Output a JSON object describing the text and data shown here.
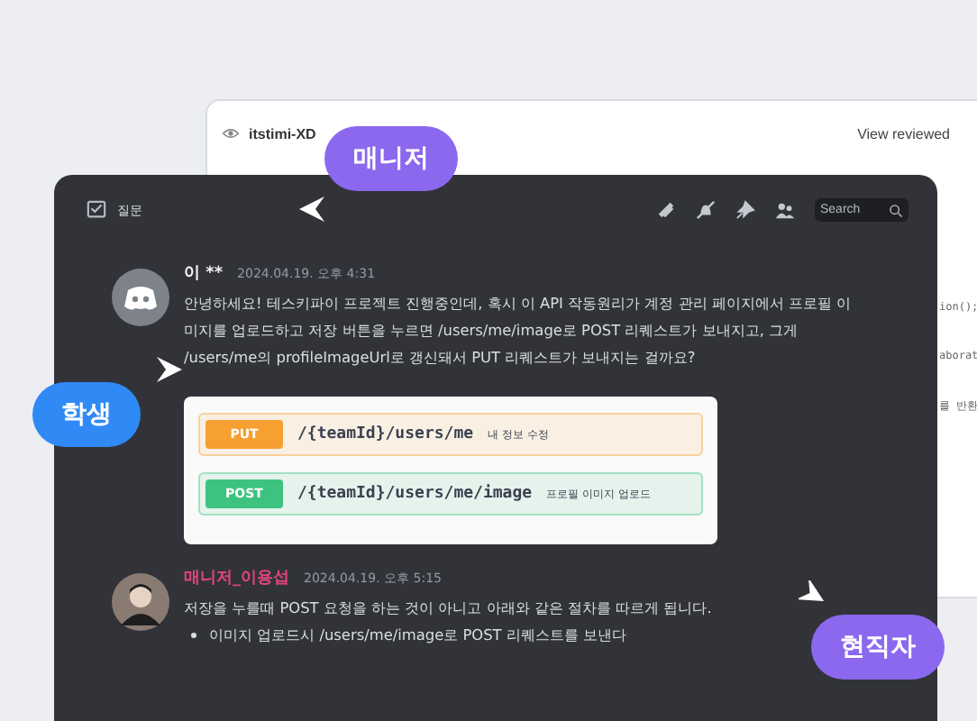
{
  "back_window": {
    "user": "itstimi-XD",
    "action": "View reviewed",
    "code_snippets": [
      "ion();",
      "aborat",
      "를 반환"
    ]
  },
  "chat": {
    "channel": "질문",
    "search": {
      "placeholder": "Search"
    },
    "messages": [
      {
        "author": "이 **",
        "color": "#f2f3f5",
        "kind": "guest",
        "time": "2024.04.19. 오후 4:31",
        "text": "안녕하세요! 테스키파이 프로젝트 진행중인데, 혹시 이 API 작동원리가 계정 관리 페이지에서 프로필 이미지를 업로드하고 저장 버튼을 누르면 /users/me/image로 POST 리퀘스트가 보내지고, 그게 /users/me의 profileImageUrl로 갱신돼서 PUT 리퀘스트가 보내지는 걸까요?",
        "endpoints": [
          {
            "method": "PUT",
            "path": "/{teamId}/users/me",
            "desc": "내 정보 수정",
            "color": "#f6a031"
          },
          {
            "method": "POST",
            "path": "/{teamId}/users/me/image",
            "desc": "프로필 이미지 업로드",
            "color": "#3dc37f"
          }
        ]
      },
      {
        "author": "매니저_이용섭",
        "color": "#e0457b",
        "kind": "staff",
        "time": "2024.04.19. 오후 5:15",
        "text": "저장을 누를때 POST 요청을 하는 것이 아니고 아래와 같은 절차를 따르게 됩니다.",
        "bullets": [
          "이미지 업로드시 /users/me/image로 POST 리퀘스트를 보낸다"
        ]
      }
    ]
  },
  "labels": [
    {
      "text": "매니저",
      "color": "#8b68ee"
    },
    {
      "text": "학생",
      "color": "#2f8af5"
    },
    {
      "text": "현직자",
      "color": "#8b68ee"
    }
  ]
}
